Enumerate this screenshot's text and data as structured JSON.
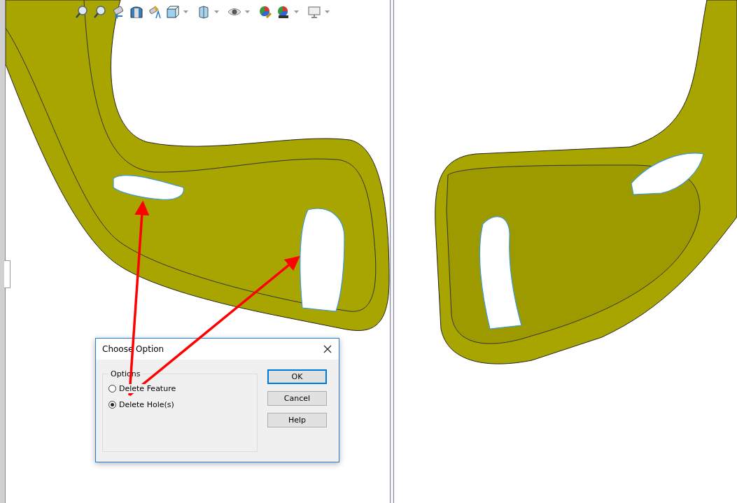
{
  "toolbar": {
    "items": [
      {
        "kind": "zoom-fit",
        "caret": false
      },
      {
        "kind": "zoom-area",
        "caret": false
      },
      {
        "kind": "previous-view",
        "caret": false
      },
      {
        "kind": "section-view",
        "caret": false
      },
      {
        "kind": "annotation-view",
        "caret": false
      },
      {
        "kind": "view-orientation",
        "caret": true
      },
      {
        "kind": "display-style",
        "caret": true
      },
      {
        "kind": "hide-show",
        "caret": true
      },
      {
        "kind": "edit-appearance",
        "caret": false
      },
      {
        "kind": "apply-scene",
        "caret": true
      },
      {
        "kind": "view-settings",
        "caret": true
      }
    ]
  },
  "dialog": {
    "title": "Choose Option",
    "group_label": "Options",
    "options": [
      {
        "label": "Delete Feature",
        "selected": false
      },
      {
        "label": "Delete Hole(s)",
        "selected": true
      }
    ],
    "buttons": [
      {
        "label": "OK",
        "default": true
      },
      {
        "label": "Cancel",
        "default": false
      },
      {
        "label": "Help",
        "default": false
      }
    ]
  }
}
